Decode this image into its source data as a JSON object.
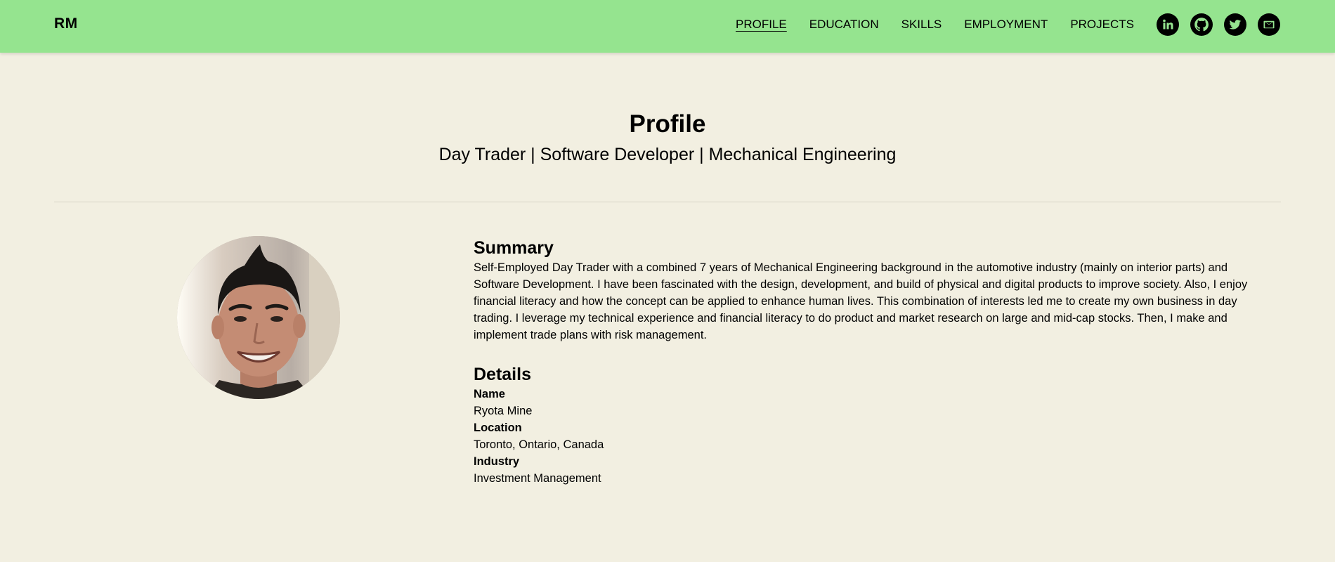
{
  "header": {
    "brand": "RM",
    "nav": [
      {
        "label": "PROFILE",
        "active": true
      },
      {
        "label": "EDUCATION",
        "active": false
      },
      {
        "label": "SKILLS",
        "active": false
      },
      {
        "label": "EMPLOYMENT",
        "active": false
      },
      {
        "label": "PROJECTS",
        "active": false
      }
    ],
    "socials": [
      {
        "icon": "linkedin-icon"
      },
      {
        "icon": "github-icon"
      },
      {
        "icon": "twitter-icon"
      },
      {
        "icon": "email-icon"
      }
    ],
    "background_color": "#95e48f"
  },
  "page": {
    "title": "Profile",
    "subtitle": "Day Trader | Software Developer | Mechanical Engineering",
    "background_color": "#f2efe1"
  },
  "summary": {
    "heading": "Summary",
    "text": "Self-Employed Day Trader with a combined 7 years of Mechanical Engineering background in the automotive industry (mainly on interior parts) and Software Development. I have been fascinated with the design, development, and build of physical and digital products to improve society. Also, I enjoy financial literacy and how the concept can be applied to enhance human lives. This combination of interests led me to create my own business in day trading. I leverage my technical experience and financial literacy to do product and market research on large and mid-cap stocks. Then, I make and implement trade plans with risk management."
  },
  "details": {
    "heading": "Details",
    "items": [
      {
        "label": "Name",
        "value": "Ryota Mine"
      },
      {
        "label": "Location",
        "value": "Toronto, Ontario, Canada"
      },
      {
        "label": "Industry",
        "value": "Investment Management"
      }
    ]
  }
}
